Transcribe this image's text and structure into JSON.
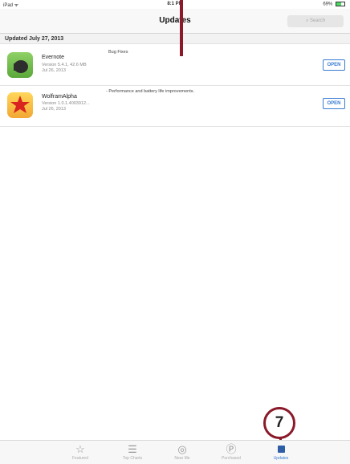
{
  "status_bar": {
    "device": "iPad ᯤ",
    "time": "8:1 PM",
    "battery": "69%"
  },
  "nav": {
    "title": "Updates",
    "search_placeholder": "Search"
  },
  "section": {
    "date_header": "Updated July 27, 2013"
  },
  "apps": [
    {
      "name": "Evernote",
      "version_info": "Version 5.4.1, 42.6 MB",
      "date": "Jul 26, 2013",
      "release_note": "Bug Fixes",
      "button": "OPEN"
    },
    {
      "name": "WolframAlpha",
      "version_info": "Version 1.0.1.4003912...",
      "date": "Jul 26, 2013",
      "release_note": "- Performance and battery life improvements.",
      "button": "OPEN"
    }
  ],
  "callout": {
    "number": "7"
  },
  "tab_bar": {
    "tabs": [
      {
        "label": "Featured",
        "icon": "star-icon"
      },
      {
        "label": "Top Charts",
        "icon": "list-icon"
      },
      {
        "label": "Near Me",
        "icon": "location-icon"
      },
      {
        "label": "Purchased",
        "icon": "purchased-icon"
      },
      {
        "label": "Updates",
        "icon": "updates-icon"
      }
    ]
  },
  "colors": {
    "accent": "#3a7cd1",
    "callout": "#8a1a2a"
  }
}
